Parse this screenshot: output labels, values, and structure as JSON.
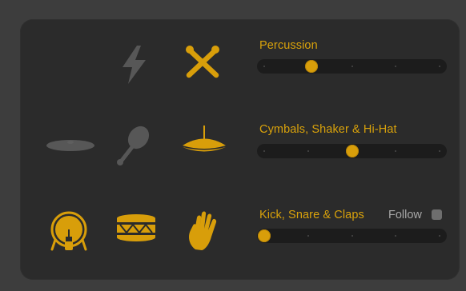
{
  "colors": {
    "accent": "#d89e0a",
    "inactive_icon": "#575757",
    "panel": "#2b2b2b",
    "track": "#1c1c1c"
  },
  "groups": [
    {
      "label": "Percussion",
      "slider_value": 0.27,
      "icons": [
        {
          "name": "empty-slot",
          "active": false
        },
        {
          "name": "lightning-icon",
          "active": false
        },
        {
          "name": "drumsticks-icon",
          "active": true
        }
      ]
    },
    {
      "label": "Cymbals, Shaker & Hi-Hat",
      "slider_value": 0.5,
      "icons": [
        {
          "name": "cymbal-icon",
          "active": false
        },
        {
          "name": "maraca-icon",
          "active": false
        },
        {
          "name": "hi-hat-icon",
          "active": true
        }
      ]
    },
    {
      "label": "Kick, Snare & Claps",
      "slider_value": 0.0,
      "follow_label": "Follow",
      "follow_checked": false,
      "icons": [
        {
          "name": "kick-drum-icon",
          "active": true
        },
        {
          "name": "snare-drum-icon",
          "active": true
        },
        {
          "name": "hand-clap-icon",
          "active": true
        }
      ]
    }
  ]
}
